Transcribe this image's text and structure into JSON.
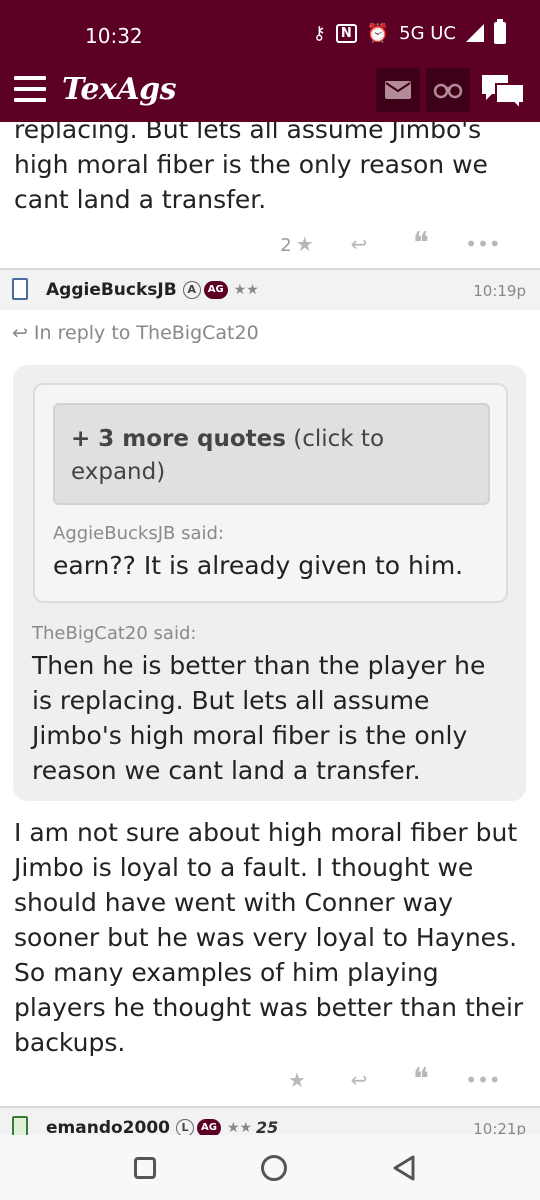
{
  "status_bar": {
    "time": "10:32",
    "network": "5G UC",
    "icons": [
      "key-icon",
      "nfc-icon",
      "alarm-icon",
      "signal-icon",
      "battery-icon"
    ]
  },
  "header": {
    "logo": "TexAgs",
    "buttons": [
      "mail-icon",
      "binoculars-icon",
      "chat-icon"
    ],
    "colors": {
      "brand": "#5c0025"
    }
  },
  "post_prev": {
    "text_tail": "replacing. But lets all assume Jimbo's high moral fiber is the only reason we cant land a transfer.",
    "star_count": "2"
  },
  "post_main": {
    "username": "AggieBucksJB",
    "badge_level": "A",
    "badge_ag": "AG",
    "stars": "★★",
    "time": "10:19p",
    "reply_to": "In reply to TheBigCat20",
    "more_quotes_bold": "+ 3 more quotes",
    "more_quotes_rest": " (click to expand)",
    "inner_said": "AggieBucksJB said:",
    "inner_text": "earn?? It is already given to him.",
    "outer_said": "TheBigCat20 said:",
    "outer_text": "Then he is better than the player he is replacing. But lets all assume Jimbo's high moral fiber is the only reason we cant land a transfer.",
    "body": "I am not sure about high moral fiber but Jimbo is loyal to a fault. I thought we should have went with Conner way sooner but he was very loyal to Haynes. So many examples of him playing players he thought was better than their backups."
  },
  "post_next": {
    "username": "emando2000",
    "badge_level": "L",
    "badge_ag": "AG",
    "stars": "★★",
    "number": "25",
    "time": "10:21p"
  },
  "nav": [
    "recents-button",
    "home-button",
    "back-button"
  ]
}
